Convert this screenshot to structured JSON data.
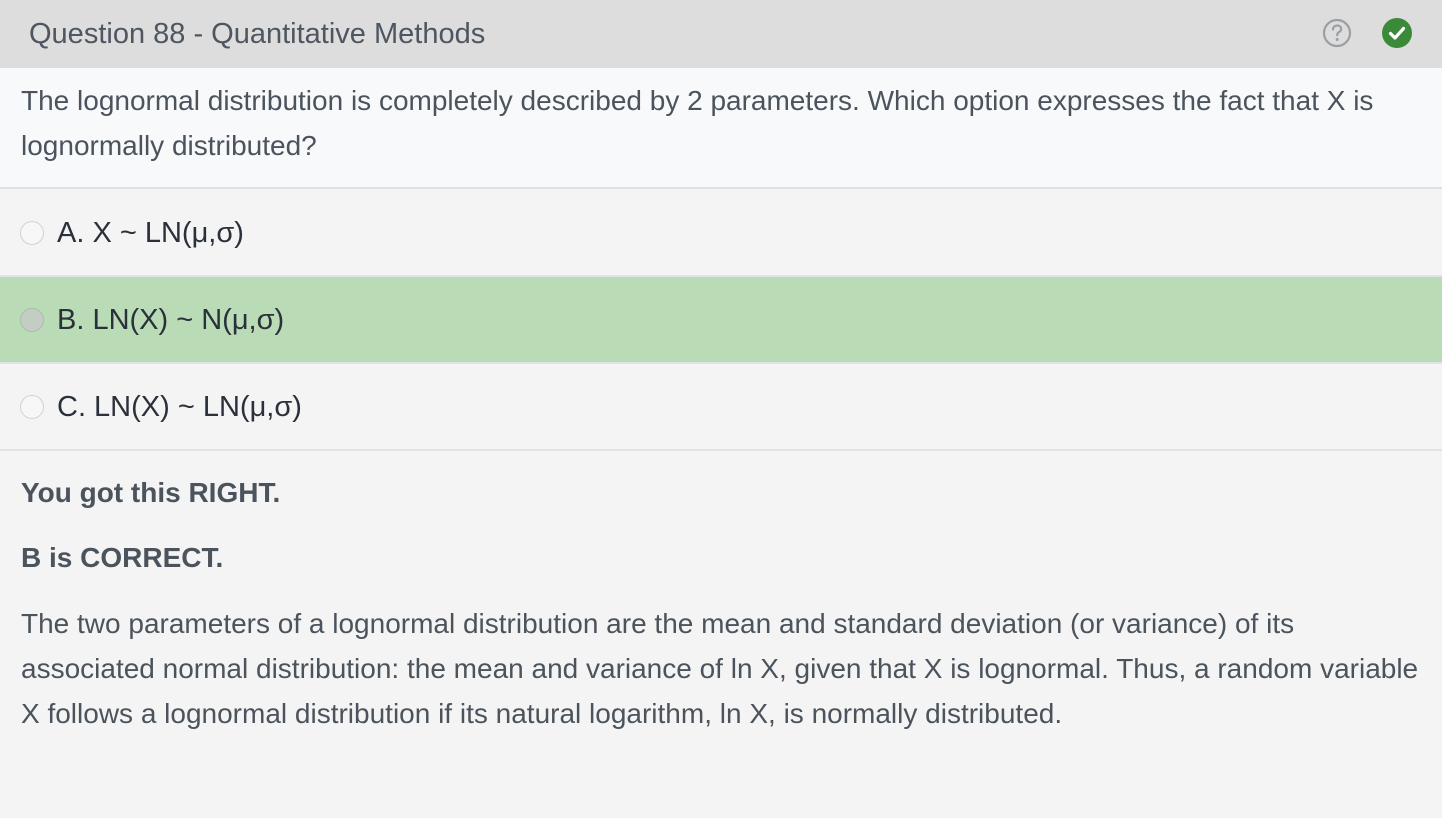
{
  "header": {
    "title": "Question 88 - Quantitative Methods",
    "help_icon": "question-circle-icon",
    "status_icon": "check-circle-icon",
    "status_color": "#3a8a3a"
  },
  "question": {
    "text": "The lognormal distribution is completely described by 2 parameters.  Which option expresses the fact that X is lognormally distributed?"
  },
  "options": [
    {
      "label": "A. X ~ LN(μ,σ)",
      "correct": false
    },
    {
      "label": "B. LN(X) ~ N(μ,σ)",
      "correct": true
    },
    {
      "label": "C. LN(X) ~ LN(μ,σ)",
      "correct": false
    }
  ],
  "explanation": {
    "result": "You got this RIGHT.",
    "correct_answer": "B is CORRECT.",
    "text": "The two parameters of a lognormal distribution are the mean and standard deviation (or variance) of its associated normal distribution: the mean and variance of ln X, given that X is lognormal.  Thus, a random variable X follows a lognormal distribution if its natural logarithm, ln X, is normally distributed."
  },
  "colors": {
    "correct_highlight": "#b9dbb6",
    "header_bg": "#dddddd"
  }
}
